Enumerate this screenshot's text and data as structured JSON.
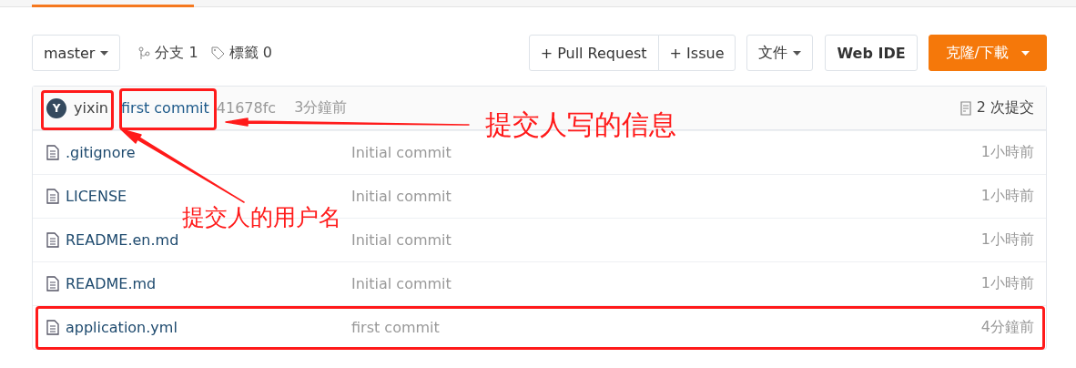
{
  "toolbar": {
    "branch": "master",
    "branches": "分支 1",
    "tags": "標籤 0",
    "buttons": [
      {
        "label": "+ Pull Request",
        "kind": "group"
      },
      {
        "label": "+ Issue",
        "kind": "group"
      },
      {
        "label": "文件",
        "kind": "dropdown"
      },
      {
        "label": "Web IDE",
        "kind": "bold"
      },
      {
        "label": "克隆/下載",
        "kind": "primary"
      }
    ]
  },
  "commit": {
    "avatar": "Y",
    "author": "yixin",
    "message": "first commit",
    "hash": "41678fc",
    "time": "3分鐘前",
    "count": "2 次提交"
  },
  "files": [
    {
      "name": ".gitignore",
      "message": "Initial commit",
      "time": "1小時前"
    },
    {
      "name": "LICENSE",
      "message": "Initial commit",
      "time": "1小時前"
    },
    {
      "name": "README.en.md",
      "message": "Initial commit",
      "time": "1小時前"
    },
    {
      "name": "README.md",
      "message": "Initial commit",
      "time": "1小時前"
    },
    {
      "name": "application.yml",
      "message": "first commit",
      "time": "4分鐘前"
    }
  ],
  "annotations": [
    {
      "label": "提交人写的信息"
    },
    {
      "label": "提交人的用户名"
    }
  ]
}
